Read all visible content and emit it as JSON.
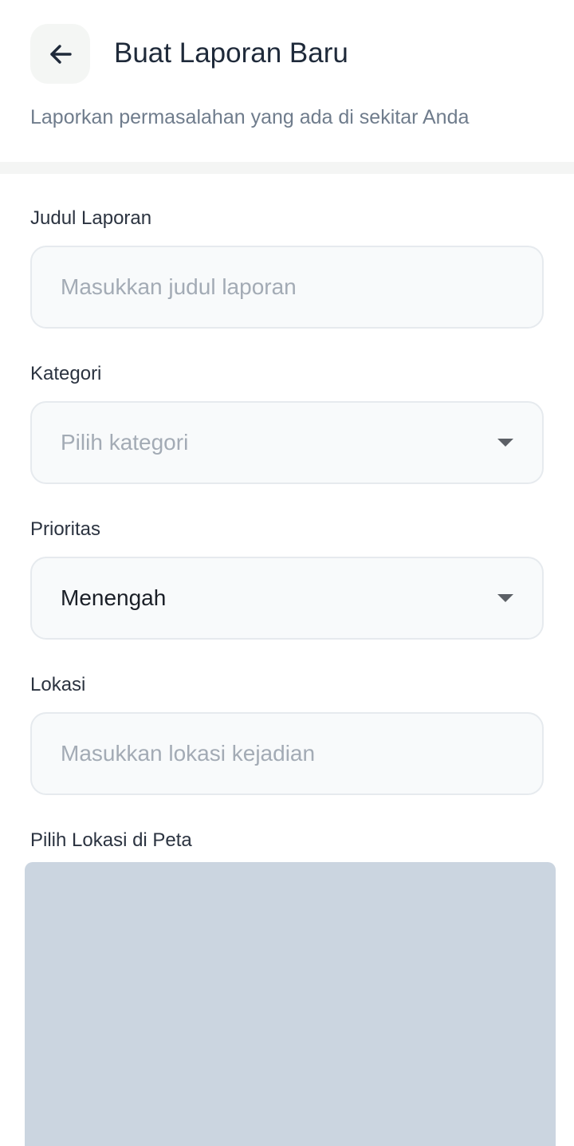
{
  "header": {
    "title": "Buat Laporan Baru",
    "subtitle": "Laporkan permasalahan yang ada di sekitar Anda",
    "back_icon": "arrow-left-icon"
  },
  "form": {
    "judul": {
      "label": "Judul Laporan",
      "placeholder": "Masukkan judul laporan",
      "value": ""
    },
    "kategori": {
      "label": "Kategori",
      "placeholder": "Pilih kategori",
      "icon": "chevron-down-icon"
    },
    "prioritas": {
      "label": "Prioritas",
      "value": "Menengah",
      "icon": "chevron-down-icon"
    },
    "lokasi": {
      "label": "Lokasi",
      "placeholder": "Masukkan lokasi kejadian",
      "value": ""
    },
    "peta": {
      "label": "Pilih Lokasi di Peta"
    }
  },
  "colors": {
    "title": "#1f2a3a",
    "subtitle": "#6f7c8c",
    "input_bg": "#f8fafb",
    "input_border": "#e6eaee",
    "placeholder": "#a3abb5",
    "map_bg": "#cbd5e0"
  }
}
